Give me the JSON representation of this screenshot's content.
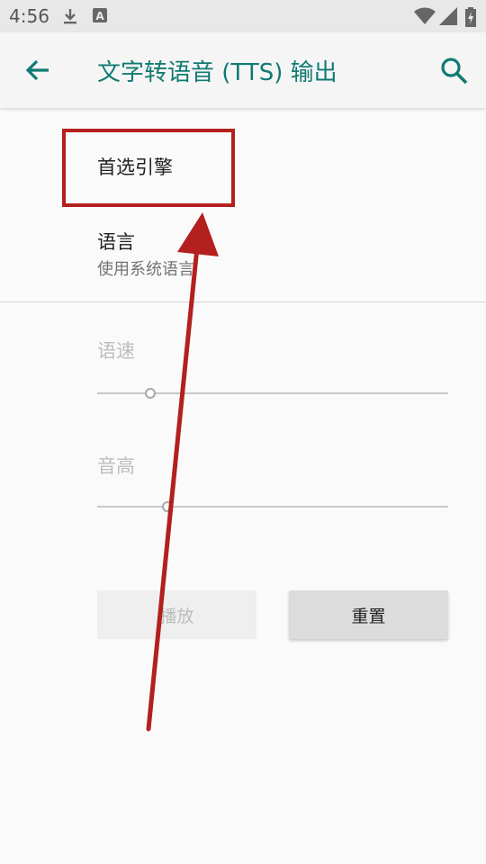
{
  "status_bar": {
    "time": "4:56",
    "icons": [
      "download-icon",
      "a-notification-icon",
      "wifi-icon",
      "signal-icon",
      "battery-charging-icon"
    ]
  },
  "toolbar": {
    "title": "文字转语音 (TTS) 输出",
    "back_icon": "arrow-back-icon",
    "search_icon": "search-icon",
    "accent_color": "#117a72"
  },
  "preferences": {
    "engine": {
      "title": "首选引擎"
    },
    "language": {
      "title": "语言",
      "summary": "使用系统语言"
    },
    "speech_rate": {
      "title": "语速",
      "level": 0.15
    },
    "pitch": {
      "title": "音高",
      "level": 0.2
    }
  },
  "buttons": {
    "play": "播放",
    "reset": "重置"
  },
  "annotation": {
    "color": "#b3201e"
  }
}
